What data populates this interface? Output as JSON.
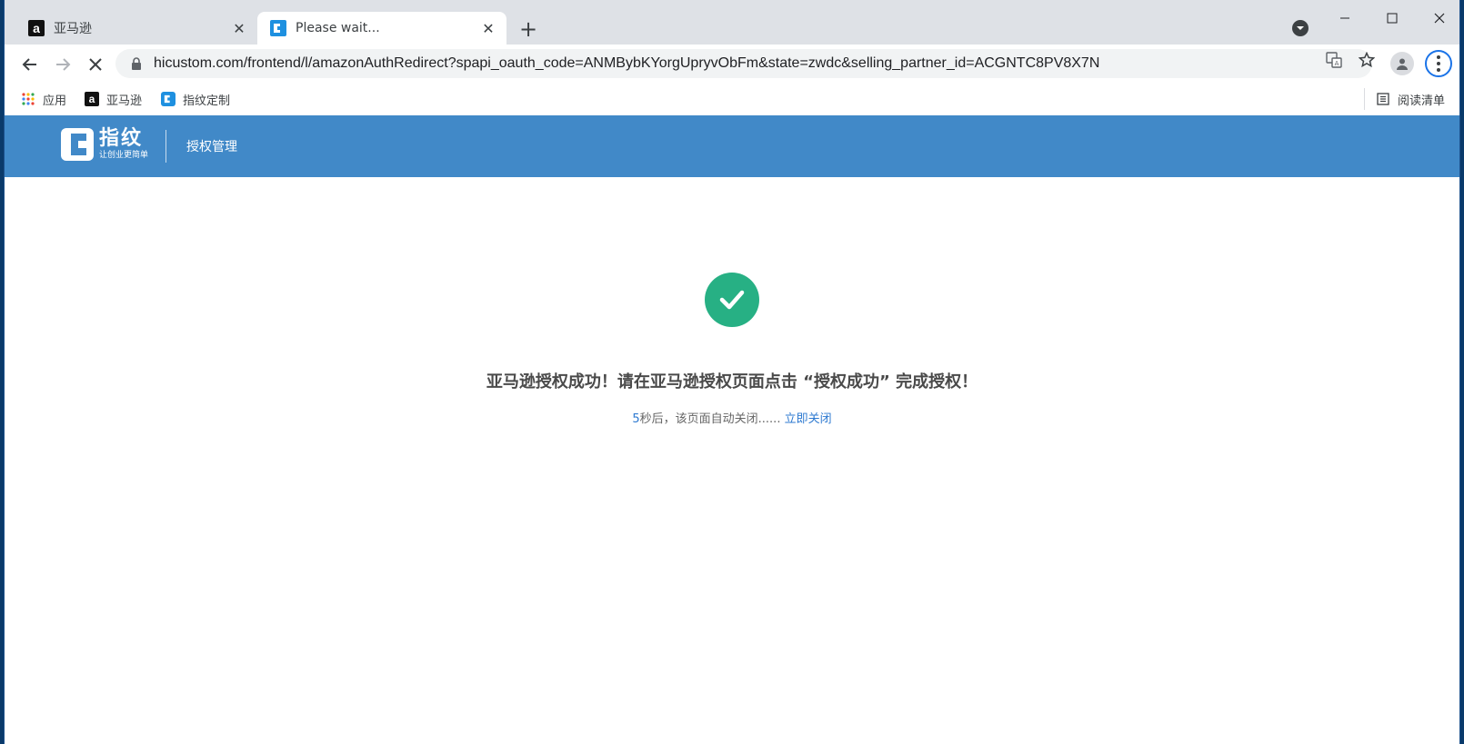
{
  "browser": {
    "tabs": [
      {
        "title": "亚马逊",
        "favicon": "amazon-icon",
        "active": false
      },
      {
        "title": "Please wait...",
        "favicon": "zhiwen-icon",
        "active": true
      }
    ],
    "url": "hicustom.com/frontend/l/amazonAuthRedirect?spapi_oauth_code=ANMBybKYorgUpryvObFm&state=zwdc&selling_partner_id=ACGNTC8PV8X7N"
  },
  "bookmarks": {
    "apps_label": "应用",
    "items": [
      {
        "label": "亚马逊",
        "icon": "amazon-icon"
      },
      {
        "label": "指纹定制",
        "icon": "zhiwen-icon"
      }
    ],
    "reading_list": "阅读清单"
  },
  "header": {
    "logo_title": "指纹",
    "logo_slogan": "让创业更简单",
    "nav_item": "授权管理",
    "bg_color": "#4189c8"
  },
  "content": {
    "success_message": "亚马逊授权成功！请在亚马逊授权页面点击 “授权成功” 完成授权！",
    "countdown_seconds": "5",
    "countdown_text": "秒后，该页面自动关闭......",
    "close_link": "立即关闭",
    "success_color": "#27b084"
  }
}
